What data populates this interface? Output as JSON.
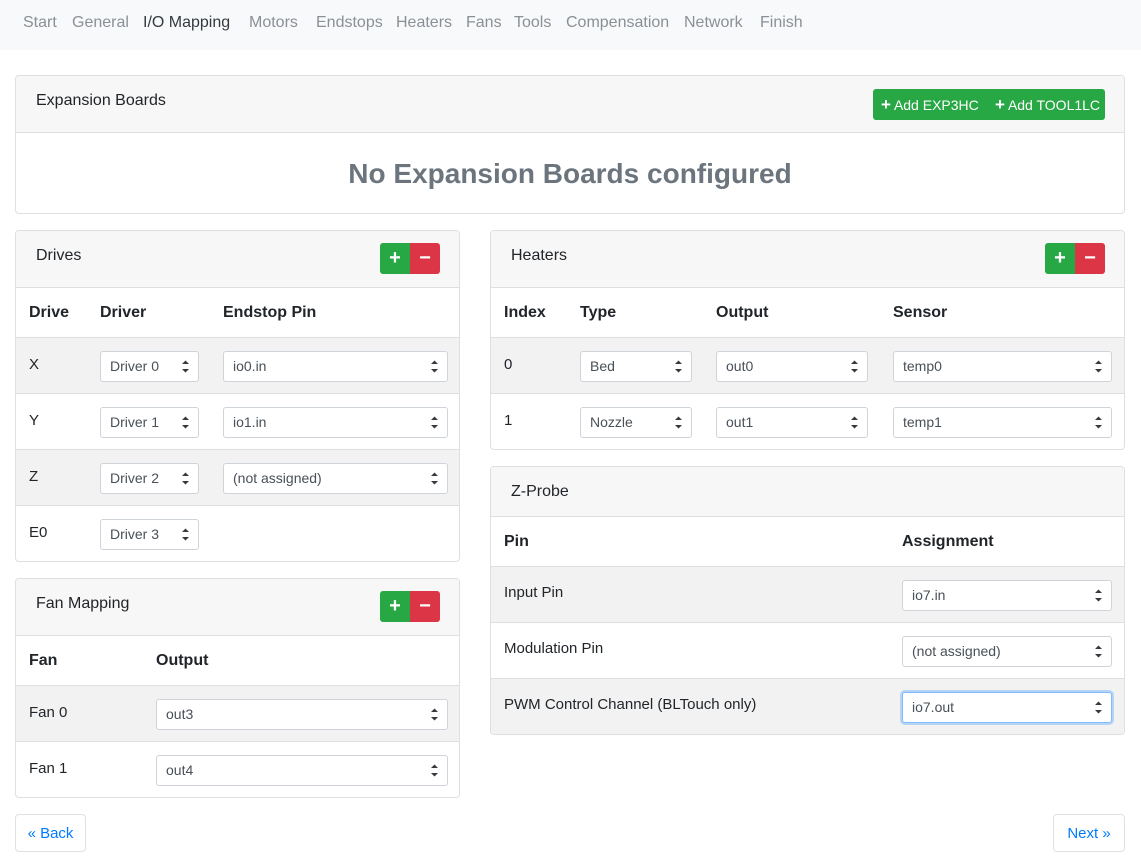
{
  "nav": {
    "tabs": [
      "Start",
      "General",
      "I/O Mapping",
      "Motors",
      "Endstops",
      "Heaters",
      "Fans",
      "Tools",
      "Compensation",
      "Network",
      "Finish"
    ],
    "active": "I/O Mapping"
  },
  "expansion": {
    "title": "Expansion Boards",
    "add_exp3hc": "Add EXP3HC",
    "add_tool1lc": "Add TOOL1LC",
    "empty": "No Expansion Boards configured"
  },
  "drives": {
    "title": "Drives",
    "headers": [
      "Drive",
      "Driver",
      "Endstop Pin"
    ],
    "rows": [
      {
        "drive": "X",
        "driver": "Driver 0",
        "endstop": "io0.in"
      },
      {
        "drive": "Y",
        "driver": "Driver 1",
        "endstop": "io1.in"
      },
      {
        "drive": "Z",
        "driver": "Driver 2",
        "endstop": "(not assigned)"
      },
      {
        "drive": "E0",
        "driver": "Driver 3",
        "endstop": null
      }
    ]
  },
  "fans": {
    "title": "Fan Mapping",
    "headers": [
      "Fan",
      "Output"
    ],
    "rows": [
      {
        "fan": "Fan 0",
        "output": "out3"
      },
      {
        "fan": "Fan 1",
        "output": "out4"
      }
    ]
  },
  "heaters": {
    "title": "Heaters",
    "headers": [
      "Index",
      "Type",
      "Output",
      "Sensor"
    ],
    "rows": [
      {
        "index": "0",
        "type": "Bed",
        "output": "out0",
        "sensor": "temp0"
      },
      {
        "index": "1",
        "type": "Nozzle",
        "output": "out1",
        "sensor": "temp1"
      }
    ]
  },
  "zprobe": {
    "title": "Z-Probe",
    "headers": [
      "Pin",
      "Assignment"
    ],
    "rows": [
      {
        "pin": "Input Pin",
        "assignment": "io7.in"
      },
      {
        "pin": "Modulation Pin",
        "assignment": "(not assigned)"
      },
      {
        "pin": "PWM Control Channel (BLTouch only)",
        "assignment": "io7.out"
      }
    ]
  },
  "footer": {
    "back": "« Back",
    "next": "Next »"
  },
  "colors": {
    "success": "#28a745",
    "danger": "#dc3545",
    "link": "#007bff"
  }
}
